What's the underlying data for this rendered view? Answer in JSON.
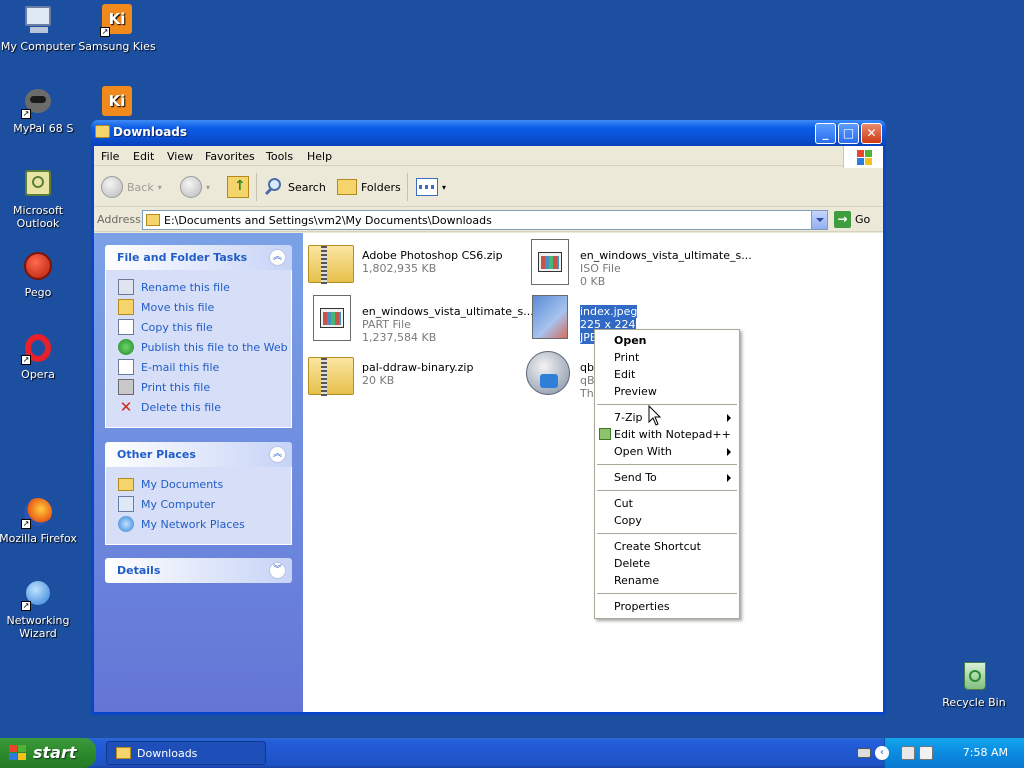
{
  "desktop": {
    "icons": [
      {
        "label": "My Computer"
      },
      {
        "label": "Samsung Kies"
      },
      {
        "label": "MyPal 68"
      },
      {
        "label": "Microsoft Outlook"
      },
      {
        "label": "Pego"
      },
      {
        "label": "Opera"
      },
      {
        "label": "Mozilla Firefox"
      },
      {
        "label": "Networking Wizard"
      },
      {
        "label": "Recycle Bin"
      }
    ],
    "shortcut_letter": "S"
  },
  "window": {
    "title": "Downloads",
    "menu": [
      "File",
      "Edit",
      "View",
      "Favorites",
      "Tools",
      "Help"
    ],
    "toolbar": {
      "back": "Back",
      "search": "Search",
      "folders": "Folders"
    },
    "address": {
      "label": "Address",
      "path": "E:\\Documents and Settings\\vm2\\My Documents\\Downloads",
      "go": "Go"
    },
    "panels": {
      "file_tasks": {
        "title": "File and Folder Tasks",
        "items": [
          "Rename this file",
          "Move this file",
          "Copy this file",
          "Publish this file to the Web",
          "E-mail this file",
          "Print this file",
          "Delete this file"
        ]
      },
      "other_places": {
        "title": "Other Places",
        "items": [
          "My Documents",
          "My Computer",
          "My Network Places"
        ]
      },
      "details": {
        "title": "Details"
      }
    },
    "files": [
      {
        "name": "Adobe Photoshop CS6.zip",
        "line1": "1,802,935 KB",
        "line2": ""
      },
      {
        "name": "en_windows_vista_ultimate_s...",
        "line1": "ISO File",
        "line2": "0 KB"
      },
      {
        "name": "en_windows_vista_ultimate_s...",
        "line1": "PART File",
        "line2": "1,237,584 KB"
      },
      {
        "name": "index.jpeg",
        "line1": "225 x 224",
        "line2": "JPEG Image"
      },
      {
        "name": "pal-ddraw-binary.zip",
        "line1": "20 KB",
        "line2": ""
      },
      {
        "name": "qbit",
        "line1": "qBit",
        "line2": "The"
      }
    ]
  },
  "context_menu": {
    "items": [
      "Open",
      "Print",
      "Edit",
      "Preview",
      "7-Zip",
      "Edit with Notepad++",
      "Open With",
      "Send To",
      "Cut",
      "Copy",
      "Create Shortcut",
      "Delete",
      "Rename",
      "Properties"
    ]
  },
  "taskbar": {
    "start": "start",
    "task": "Downloads",
    "clock": "7:58 AM"
  },
  "colors": {
    "desktop": "#1d4fa0",
    "selection": "#316ac5",
    "link": "#215dc6"
  }
}
